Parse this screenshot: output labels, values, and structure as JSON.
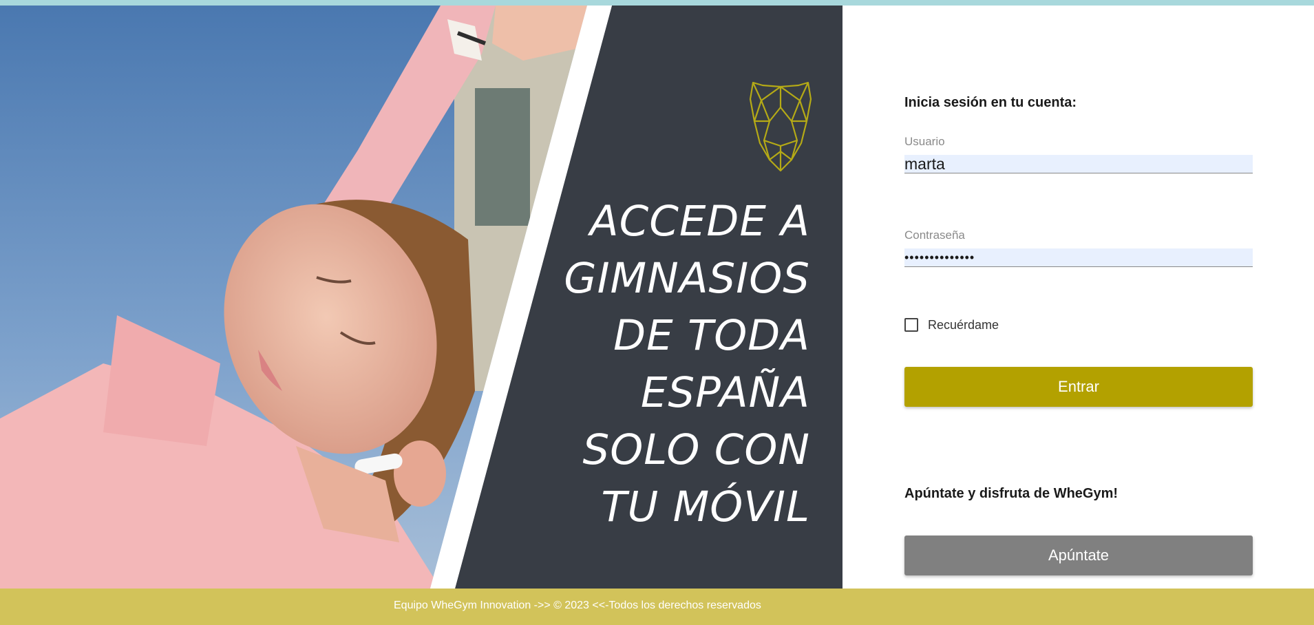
{
  "promo": {
    "lines": [
      "ACCEDE A",
      "GIMNASIOS",
      "DE TODA",
      "ESPAÑA",
      "SOLO CON",
      "TU MÓVIL"
    ]
  },
  "login": {
    "heading": "Inicia sesión en tu cuenta:",
    "username_label": "Usuario",
    "username_value": "marta",
    "password_label": "Contraseña",
    "password_value": "••••••••••••••",
    "remember_label": "Recuérdame",
    "remember_checked": false,
    "submit_label": "Entrar"
  },
  "signup": {
    "heading": "Apúntate y disfruta de WheGym!",
    "button_label": "Apúntate"
  },
  "footer": {
    "text": "Equipo WheGym Innovation ->> © 2023 <<-Todos los derechos reservados"
  },
  "colors": {
    "accent": "#b3a100",
    "dark_panel": "#383d45",
    "footer": "#d2c35a",
    "signup_button": "#808080"
  },
  "icons": {
    "logo": "geometric-panther-head-icon"
  }
}
